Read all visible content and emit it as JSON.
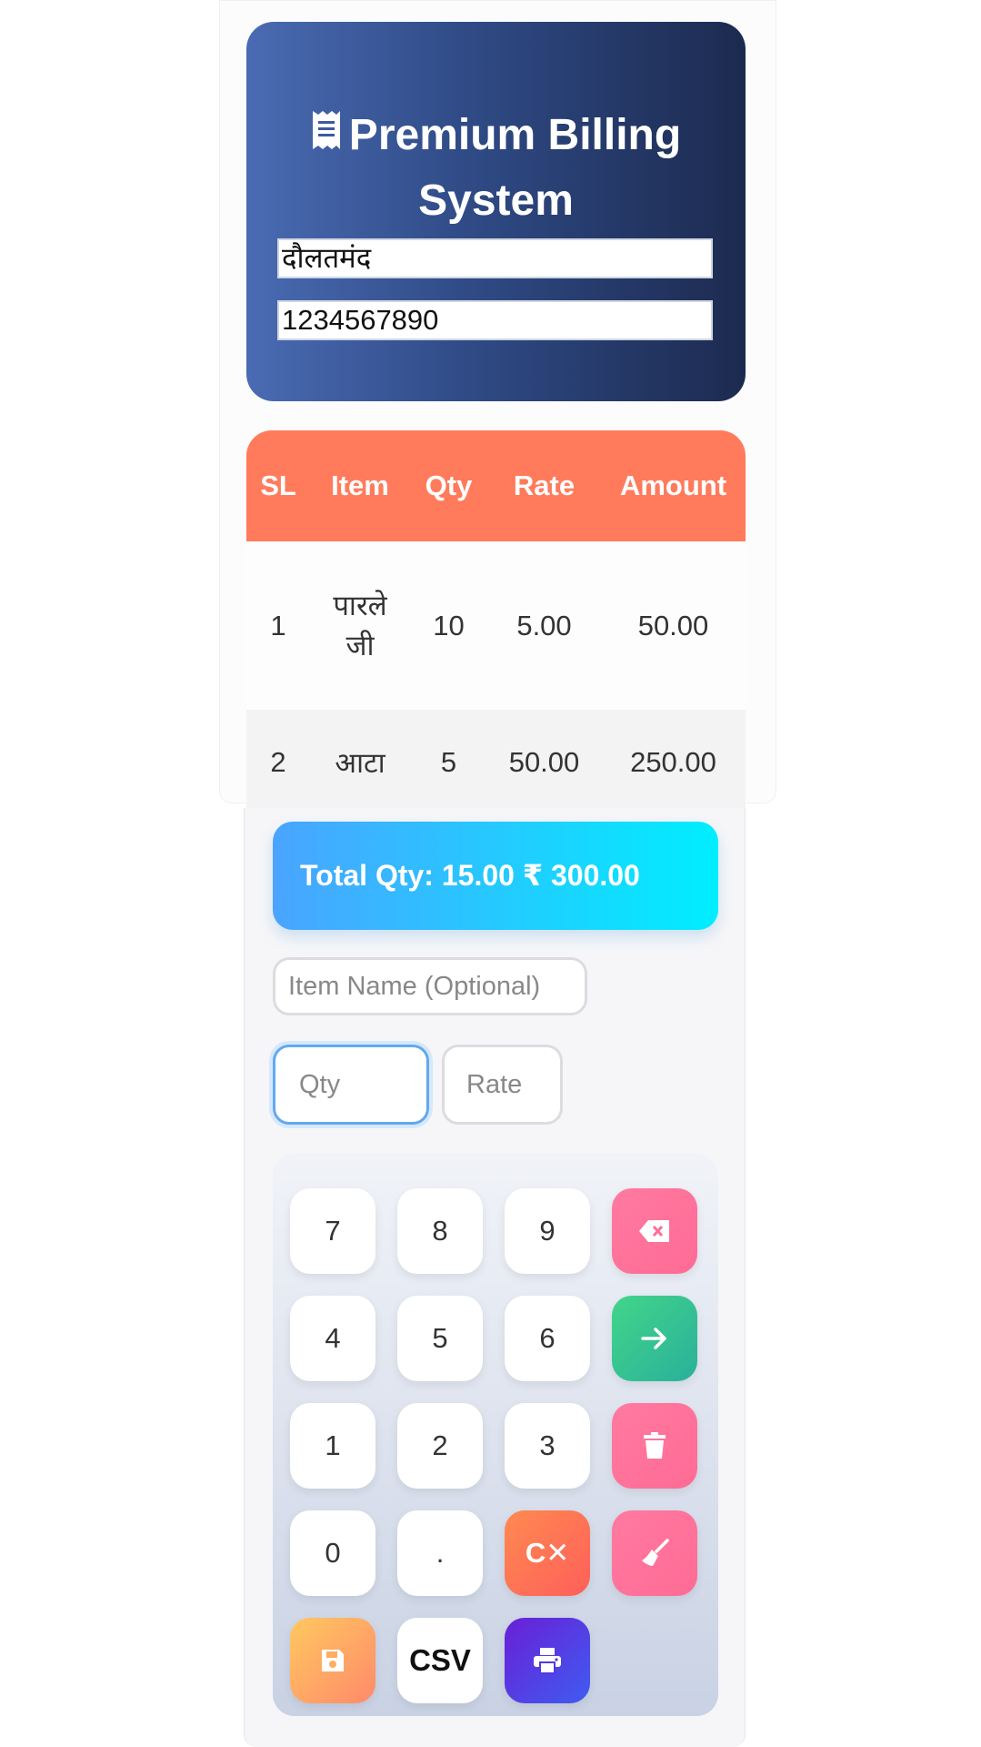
{
  "header": {
    "title_line1": "Premium Billing",
    "title_line2": "System",
    "title_icon": "receipt-icon",
    "customer_name": "दौलतमंद",
    "customer_phone": "1234567890"
  },
  "table": {
    "columns": [
      "SL",
      "Item",
      "Qty",
      "Rate",
      "Amount"
    ],
    "rows": [
      {
        "sl": "1",
        "item_line1": "पारले",
        "item_line2": "जी",
        "qty": "10",
        "rate": "5.00",
        "amount": "50.00"
      },
      {
        "sl": "2",
        "item": "आटा",
        "qty": "5",
        "rate": "50.00",
        "amount": "250.00"
      }
    ]
  },
  "total": {
    "label": "Total Qty: 15.00 ₹ 300.00"
  },
  "inputs": {
    "item_name_placeholder": "Item Name (Optional)",
    "qty_placeholder": "Qty",
    "rate_placeholder": "Rate"
  },
  "keypad": {
    "k7": "7",
    "k8": "8",
    "k9": "9",
    "k4": "4",
    "k5": "5",
    "k6": "6",
    "k1": "1",
    "k2": "2",
    "k3": "3",
    "k0": "0",
    "kdot": ".",
    "clear_x": "C✕",
    "csv": "CSV"
  },
  "colors": {
    "header_gradient_start": "#4a6bb3",
    "header_gradient_end": "#1c2a4f",
    "table_header": "#ff7b5c",
    "total_gradient_start": "#4aa4ff",
    "total_gradient_end": "#00eeff"
  }
}
